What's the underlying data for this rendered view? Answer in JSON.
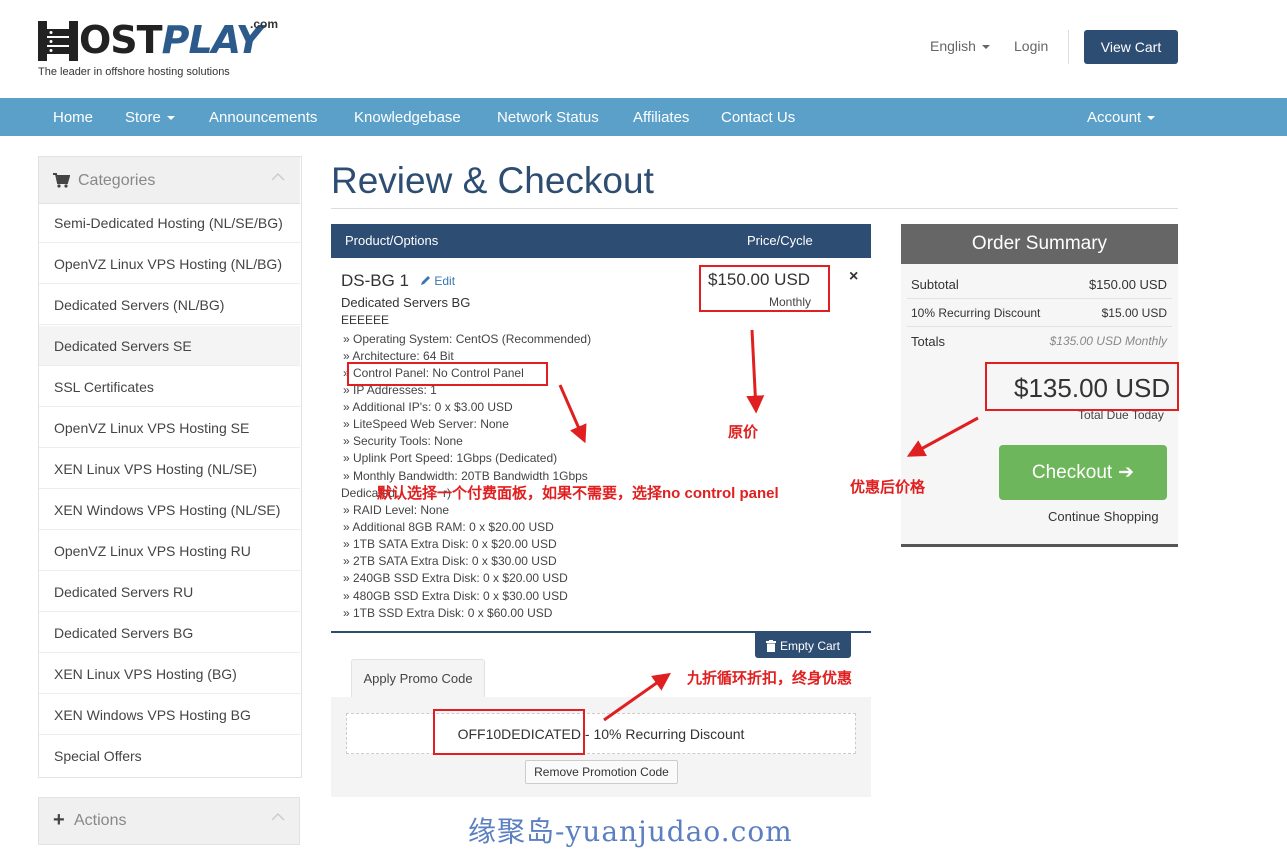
{
  "header": {
    "logo_text_a": "OST",
    "logo_text_b": "PLAY",
    "logo_com": ".com",
    "logo_tagline": "The leader in offshore hosting solutions",
    "language": "English",
    "login": "Login",
    "view_cart": "View Cart"
  },
  "nav": {
    "home": "Home",
    "store": "Store",
    "announcements": "Announcements",
    "knowledgebase": "Knowledgebase",
    "network_status": "Network Status",
    "affiliates": "Affiliates",
    "contact_us": "Contact Us",
    "account": "Account"
  },
  "sidebar": {
    "categories_title": "Categories",
    "items": [
      "Semi-Dedicated Hosting (NL/SE/BG)",
      "OpenVZ Linux VPS Hosting (NL/BG)",
      "Dedicated Servers (NL/BG)",
      "Dedicated Servers SE",
      "SSL Certificates",
      "OpenVZ Linux VPS Hosting SE",
      "XEN Linux VPS Hosting (NL/SE)",
      "XEN Windows VPS Hosting (NL/SE)",
      "OpenVZ Linux VPS Hosting RU",
      "Dedicated Servers RU",
      "Dedicated Servers BG",
      "XEN Linux VPS Hosting (BG)",
      "XEN Windows VPS Hosting BG",
      "Special Offers"
    ],
    "actions_title": "Actions"
  },
  "main": {
    "title": "Review & Checkout",
    "col_product": "Product/Options",
    "col_price": "Price/Cycle",
    "product": {
      "name": "DS-BG 1",
      "edit": "Edit",
      "group": "Dedicated Servers BG",
      "hostname": "EEEEEE",
      "price": "$150.00 USD",
      "cycle": "Monthly",
      "remove": "×",
      "options_a": [
        "» Operating System: CentOS (Recommended)",
        "» Architecture: 64 Bit",
        "» Control Panel: No Control Panel",
        "» IP Addresses: 1",
        "» Additional IP's: 0 x $3.00 USD",
        "» LiteSpeed Web Server: None",
        "» Security Tools: None",
        "» Uplink Port Speed: 1Gbps (Dedicated)",
        "» Monthly Bandwidth: 20TB Bandwidth 1Gbps"
      ],
      "options_b_partial": "Dedicated",
      "options_b_tail": "r)",
      "options_c": [
        "» RAID Level: None",
        "» Additional 8GB RAM: 0 x $20.00 USD",
        "» 1TB SATA Extra Disk: 0 x $20.00 USD",
        "» 2TB SATA Extra Disk: 0 x $30.00 USD",
        "» 240GB SSD Extra Disk: 0 x $20.00 USD",
        "» 480GB SSD Extra Disk: 0 x $30.00 USD",
        "» 1TB SSD Extra Disk: 0 x $60.00 USD"
      ]
    },
    "empty_cart": "Empty Cart",
    "apply_promo": "Apply Promo Code",
    "promo_applied": "OFF10DEDICATED - 10% Recurring Discount",
    "remove_promo": "Remove Promotion Code"
  },
  "summary": {
    "title": "Order Summary",
    "subtotal_label": "Subtotal",
    "subtotal_value": "$150.00 USD",
    "discount_label": "10% Recurring Discount",
    "discount_value": "$15.00 USD",
    "totals_label": "Totals",
    "totals_value": "$135.00 USD Monthly",
    "total_due": "$135.00 USD",
    "total_due_label": "Total Due Today",
    "checkout": "Checkout",
    "continue": "Continue Shopping"
  },
  "annotations": {
    "original_price": "原价",
    "discounted_price": "优惠后价格",
    "control_panel_note": "默认选择一个付费面板，如果不需要，选择no control panel",
    "promo_note": "九折循环折扣，终身优惠",
    "watermark": "缘聚岛-yuanjudao.com",
    "color": "#e02020"
  }
}
